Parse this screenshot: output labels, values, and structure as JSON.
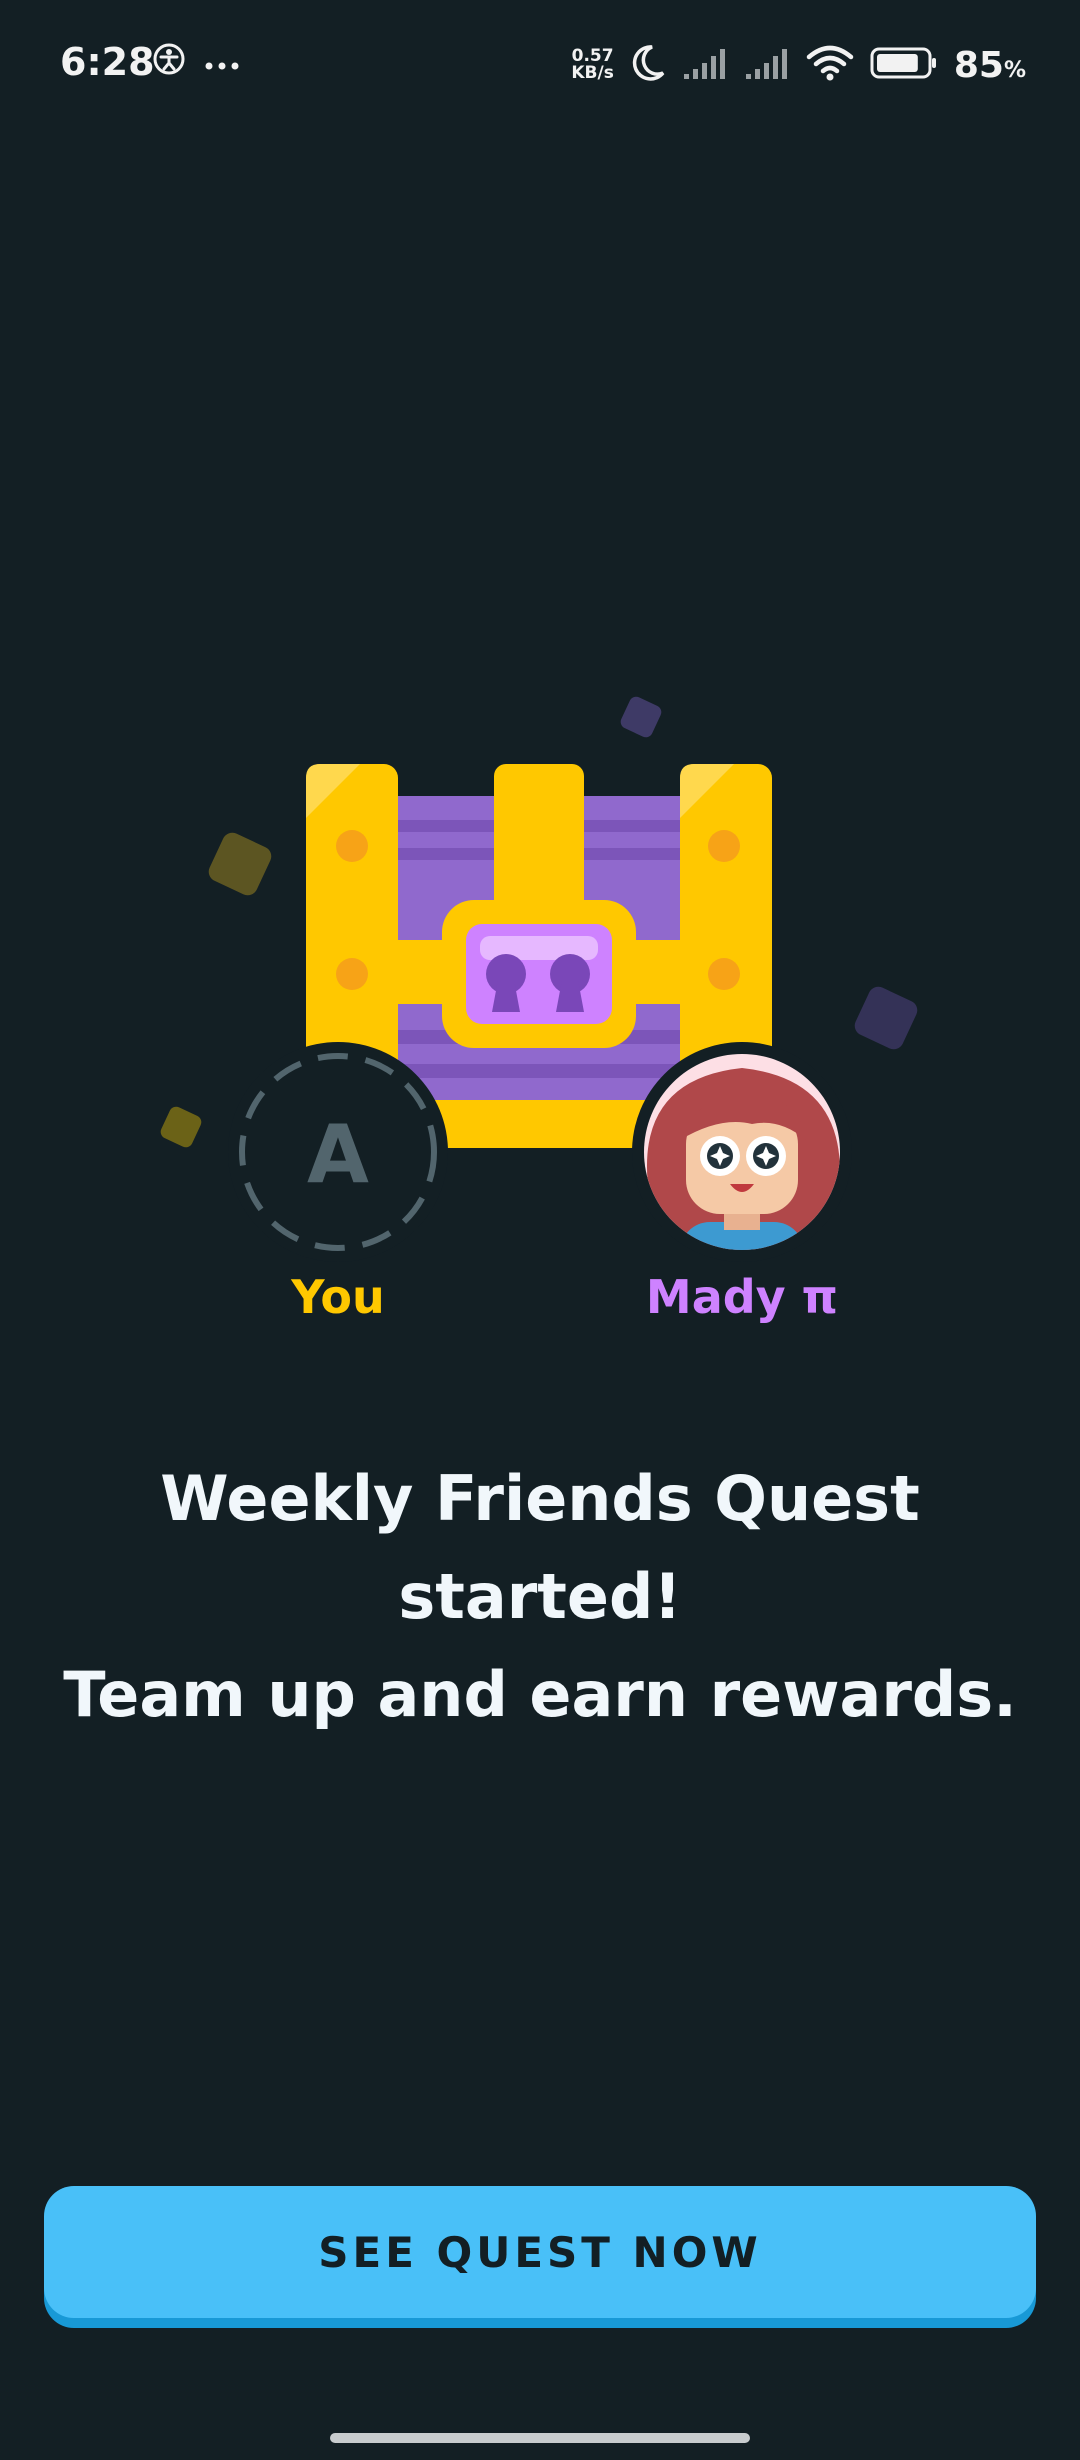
{
  "status_bar": {
    "time": "6:28",
    "net_speed_value": "0.57",
    "net_speed_unit": "KB/s",
    "battery_percent": "85",
    "battery_unit": "%",
    "battery_level": 0.85,
    "icons": [
      "accessibility-icon",
      "more-dots-icon",
      "moon-icon",
      "signal-icon",
      "signal-icon",
      "wifi-icon",
      "battery-icon"
    ]
  },
  "quest": {
    "you_initial": "A",
    "you_label": "You",
    "friend_label": "Mady π",
    "headline_line1": "Weekly Friends Quest started!",
    "headline_line2": "Team up and earn rewards."
  },
  "cta": {
    "label": "SEE QUEST NOW"
  },
  "colors": {
    "background": "#131f24",
    "you_color": "#ffc800",
    "friend_color": "#ce82ff",
    "button": "#49c0f8",
    "button_shadow": "#1899d6",
    "chest_gold": "#ffc800",
    "chest_purple": "#9069cd"
  }
}
